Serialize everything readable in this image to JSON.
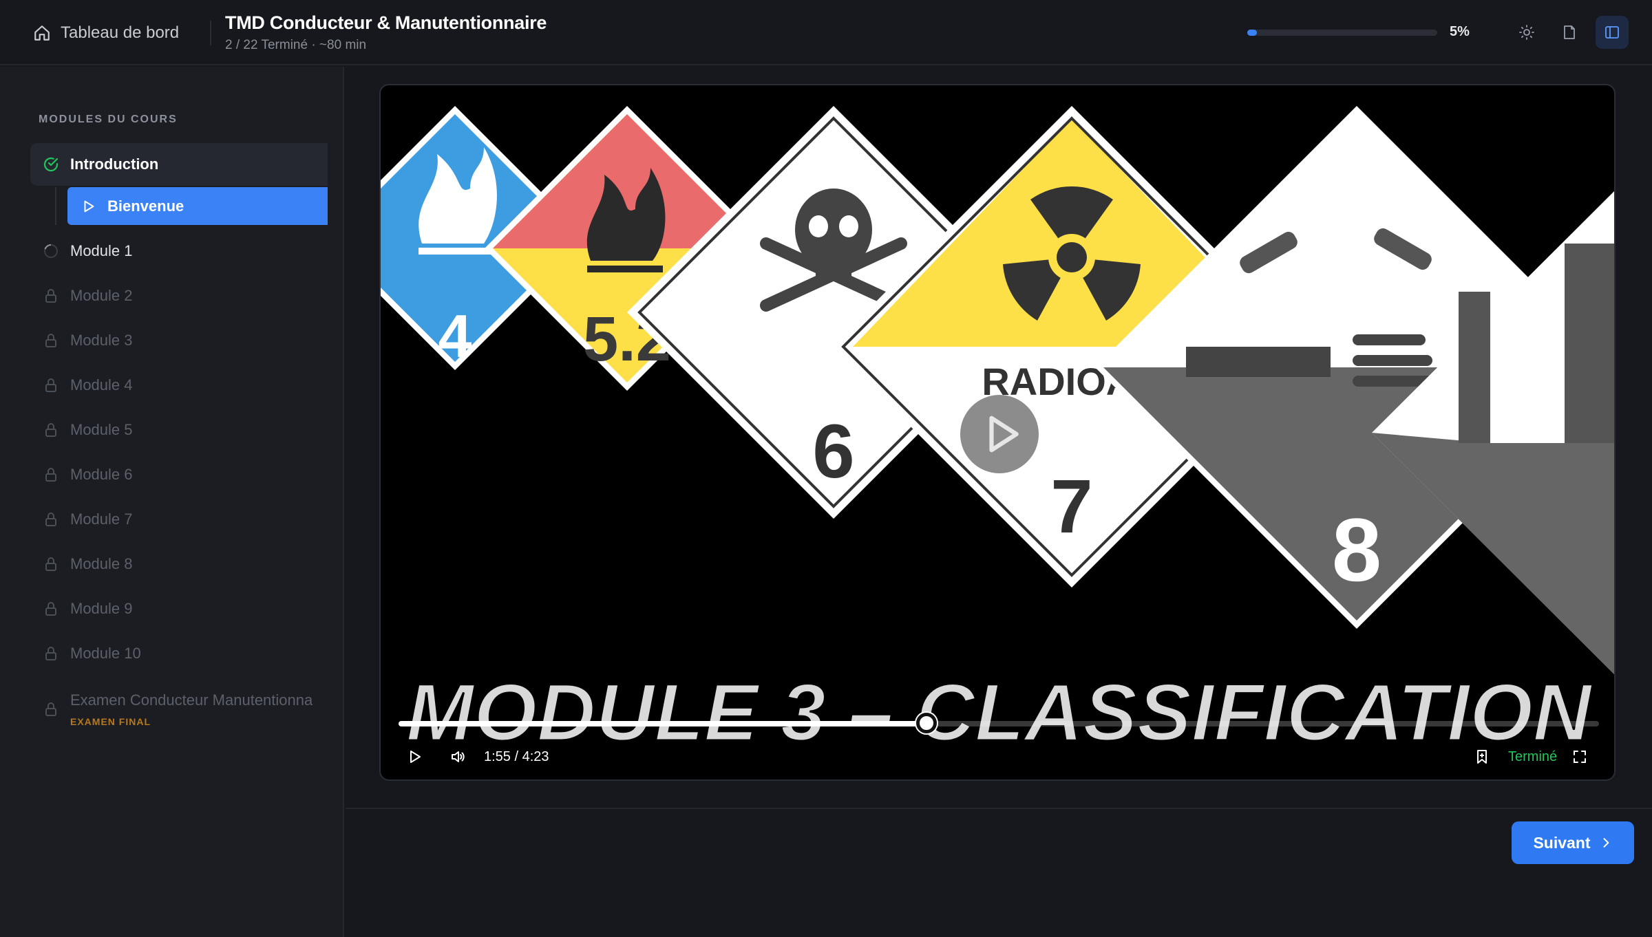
{
  "header": {
    "home_label": "Tableau de bord",
    "course_title": "TMD Conducteur & Manutentionnaire",
    "course_subtitle": "2 / 22 Terminé · ~80 min",
    "progress_percent": 5,
    "progress_label": "5%"
  },
  "sidebar": {
    "heading": "MODULES DU COURS",
    "modules": [
      {
        "label": "Introduction",
        "state": "completed"
      },
      {
        "label": "Module 1",
        "state": "in-progress"
      },
      {
        "label": "Module 2",
        "state": "locked"
      },
      {
        "label": "Module 3",
        "state": "locked"
      },
      {
        "label": "Module 4",
        "state": "locked"
      },
      {
        "label": "Module 5",
        "state": "locked"
      },
      {
        "label": "Module 6",
        "state": "locked"
      },
      {
        "label": "Module 7",
        "state": "locked"
      },
      {
        "label": "Module 8",
        "state": "locked"
      },
      {
        "label": "Module 9",
        "state": "locked"
      },
      {
        "label": "Module 10",
        "state": "locked"
      }
    ],
    "active_lesson": "Bienvenue",
    "exam": {
      "title": "Examen Conducteur Manutentionna",
      "badge": "EXAMEN FINAL"
    }
  },
  "video": {
    "hazard_labels": [
      "4",
      "5.2",
      "6",
      "RADIOAC",
      "7",
      "8"
    ],
    "overlay_title": "MODULE 3 – CLASSIFICATION",
    "played_fraction": 0.44,
    "time_readout": "1:55 / 4:23",
    "status_label": "Terminé"
  },
  "footer": {
    "next_label": "Suivant"
  },
  "colors": {
    "accent": "#3b82f6",
    "success": "#22c55e",
    "exam_badge": "#b7791f"
  },
  "icons": [
    "home-icon",
    "sun-icon",
    "file-icon",
    "sidebar-toggle-icon",
    "check-circle-icon",
    "play-icon",
    "progress-circle-icon",
    "lock-icon",
    "volume-icon",
    "bookmark-icon",
    "fullscreen-icon",
    "chevron-right-icon"
  ]
}
